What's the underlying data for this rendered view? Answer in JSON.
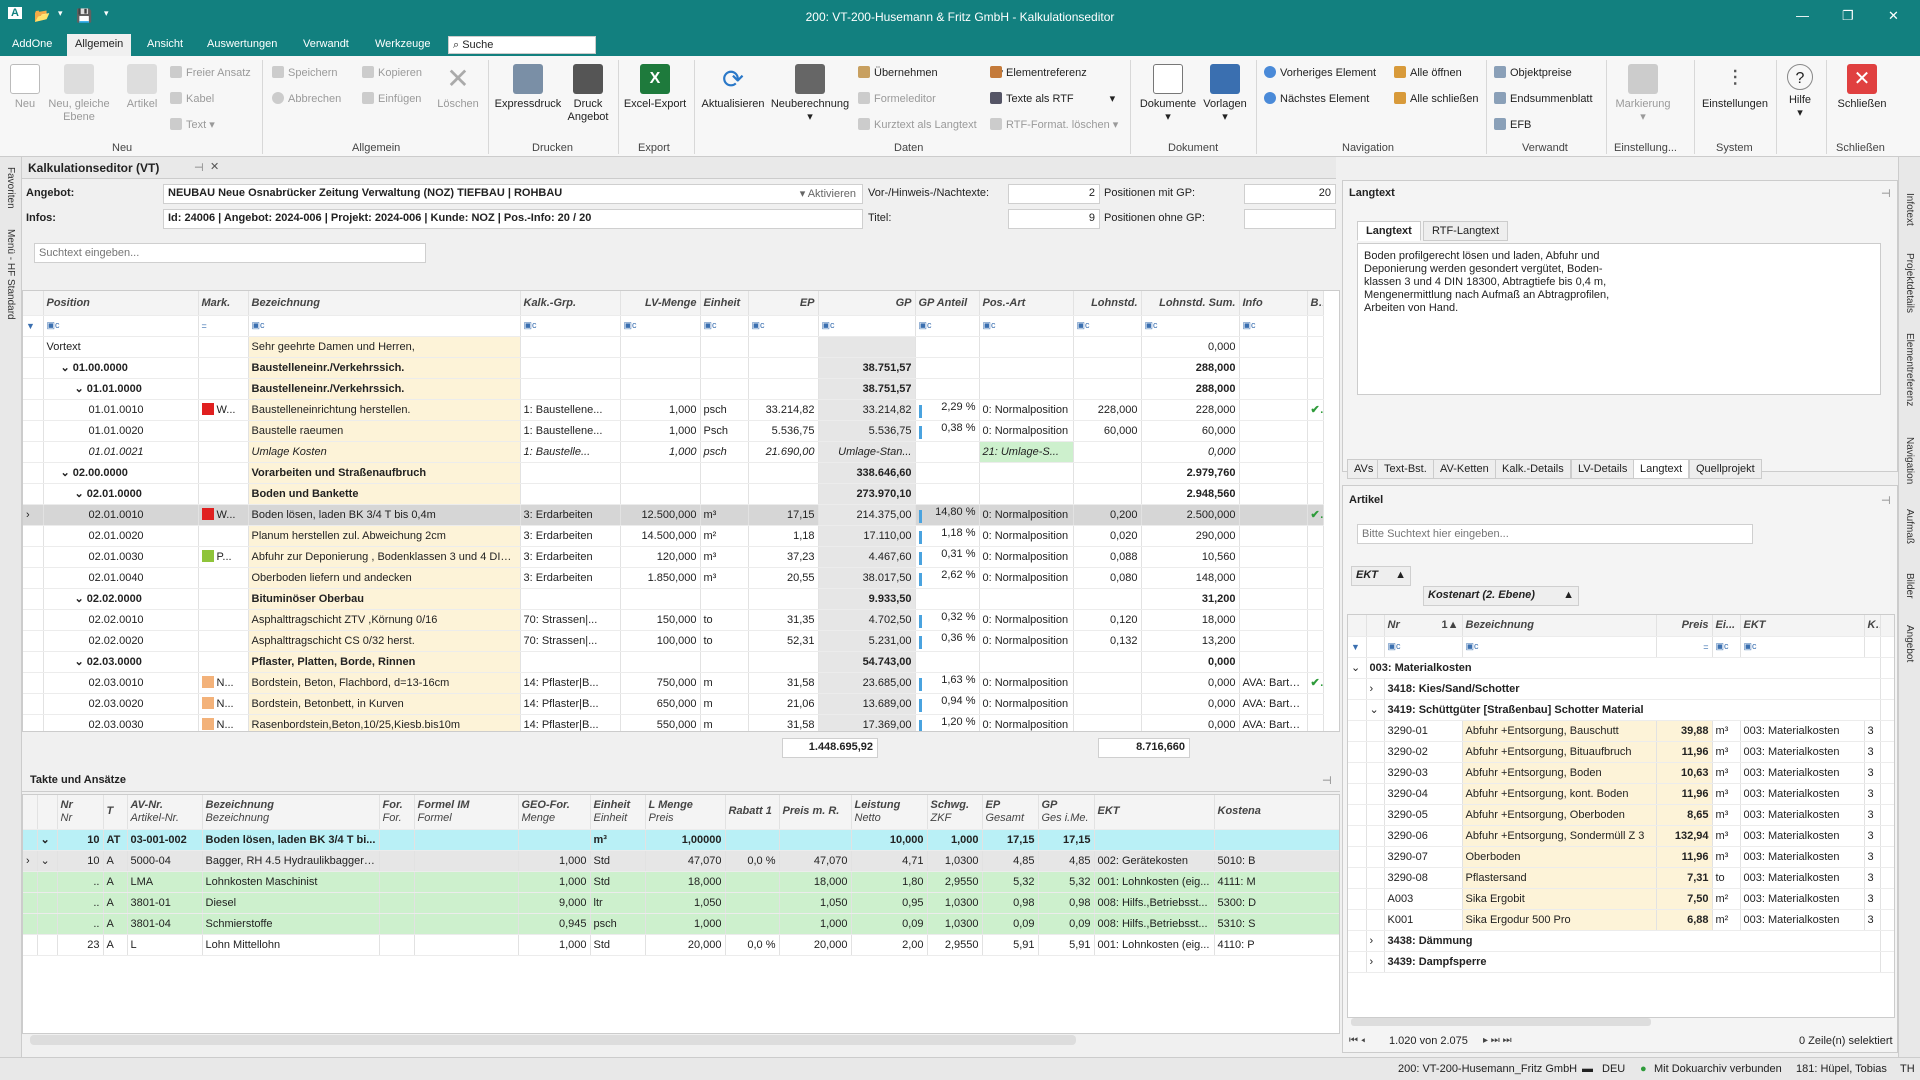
{
  "window": {
    "title": "200: VT-200-Husemann & Fritz GmbH - Kalkulationseditor",
    "app_letter": "A"
  },
  "menu": {
    "items": [
      "AddOne",
      "Allgemein",
      "Ansicht",
      "Auswertungen",
      "Verwandt",
      "Werkzeuge"
    ],
    "search_value": "Suche"
  },
  "ribbon": {
    "neu": "Neu",
    "neu_gleiche": "Neu, gleiche",
    "ebene": "Ebene",
    "artikel": "Artikel",
    "freier_ansatz": "Freier Ansatz",
    "kabel": "Kabel",
    "text": "Text",
    "speichern": "Speichern",
    "abbrechen": "Abbrechen",
    "kopieren": "Kopieren",
    "einfuegen": "Einfügen",
    "loeschen": "Löschen",
    "expressdruck": "Expressdruck",
    "druck": "Druck",
    "angebot": "Angebot",
    "excel_export": "Excel-Export",
    "aktualisieren": "Aktualisieren",
    "neuberechnung": "Neuberechnung",
    "uebernehmen": "Übernehmen",
    "formeleditor": "Formeleditor",
    "kurztext": "Kurztext als Langtext",
    "elementreferenz": "Elementreferenz",
    "texte_rtf": "Texte als RTF",
    "rtf_loeschen": "RTF-Format. löschen",
    "dokumente": "Dokumente",
    "vorlagen": "Vorlagen",
    "vorheriges": "Vorheriges Element",
    "naechstes": "Nächstes Element",
    "alle_oeffnen": "Alle öffnen",
    "alle_schliessen": "Alle schließen",
    "objektpreise": "Objektpreise",
    "endsummenblatt": "Endsummenblatt",
    "efb": "EFB",
    "markierung": "Markierung",
    "einstellungen": "Einstellungen",
    "hilfe": "Hilfe",
    "schliessen": "Schließen",
    "groups": [
      "Neu",
      "Allgemein",
      "Drucken",
      "Export",
      "Daten",
      "Dokument",
      "Navigation",
      "Verwandt",
      "Einstellung...",
      "System",
      "Schließen"
    ]
  },
  "left_strip": [
    "Favoriten",
    "Menü - HF Standard"
  ],
  "right_strip": [
    "Infotext",
    "Projektdetails",
    "Elementreferenz",
    "Navigation",
    "Aufmaß",
    "Bilder",
    "Angebot"
  ],
  "editor": {
    "tab_title": "Kalkulationseditor (VT)",
    "angebot_label": "Angebot:",
    "angebot_value": "NEUBAU Neue Osnabrücker Zeitung Verwaltung (NOZ) TIEFBAU | ROHBAU",
    "aktivieren": "Aktivieren",
    "infos_label": "Infos:",
    "infos_value": "Id: 24006 | Angebot: 2024-006 | Projekt: 2024-006 | Kunde: NOZ | Pos.-Info: 20 / 20",
    "vor_label": "Vor-/Hinweis-/Nachtexte:",
    "vor_value": "2",
    "titel_label": "Titel:",
    "titel_value": "9",
    "pos_gp_label": "Positionen mit GP:",
    "pos_gp_value": "20",
    "pos_ohne_label": "Positionen ohne GP:",
    "pos_ohne_value": "",
    "search_placeholder": "Suchtext eingeben...",
    "columns": [
      "Position",
      "Mark.",
      "Bezeichnung",
      "Kalk.-Grp.",
      "LV-Menge",
      "Einheit",
      "EP",
      "GP",
      "GP Anteil",
      "Pos.-Art",
      "Lohnstd.",
      "Lohnstd. Sum.",
      "Info",
      "Bilder"
    ],
    "rows": [
      {
        "pos": "Vortext",
        "bez": "Sehr geehrte Damen und Herren,",
        "ls": "0,000",
        "lvl": 0,
        "type": "text"
      },
      {
        "pos": "01.00.0000",
        "bez": "Baustelleneinr./Verkehrssich.",
        "gp": "38.751,57",
        "ls": "288,000",
        "lvl": 1,
        "type": "bold"
      },
      {
        "pos": "01.01.0000",
        "bez": "Baustelleneinr./Verkehrssich.",
        "gp": "38.751,57",
        "ls": "288,000",
        "lvl": 2,
        "type": "bold"
      },
      {
        "pos": "01.01.0010",
        "mark": "W...",
        "mc": "#e02020",
        "bez": "Baustelleneinrichtung herstellen.",
        "kg": "1: Baustellene...",
        "menge": "1,000",
        "eh": "psch",
        "ep": "33.214,82",
        "gp": "33.214,82",
        "ant": "2,29 %",
        "art": "0: Normalposition",
        "lh": "228,000",
        "ls": "228,000",
        "chk": "✔",
        "lvl": 3
      },
      {
        "pos": "01.01.0020",
        "bez": "Baustelle raeumen",
        "kg": "1: Baustellene...",
        "menge": "1,000",
        "eh": "Psch",
        "ep": "5.536,75",
        "gp": "5.536,75",
        "ant": "0,38 %",
        "art": "0: Normalposition",
        "lh": "60,000",
        "ls": "60,000",
        "lvl": 3
      },
      {
        "pos": "01.01.0021",
        "bez": "Umlage Kosten",
        "kg": "1: Baustelle...",
        "menge": "1,000",
        "eh": "psch",
        "ep": "21.690,00",
        "gp": "Umlage-Stan...",
        "art": "21: Umlage-S...",
        "ls": "0,000",
        "lvl": 3,
        "type": "italic"
      },
      {
        "pos": "02.00.0000",
        "bez": "Vorarbeiten und Straßenaufbruch",
        "gp": "338.646,60",
        "ls": "2.979,760",
        "lvl": 1,
        "type": "bold"
      },
      {
        "pos": "02.01.0000",
        "bez": "Boden und Bankette",
        "gp": "273.970,10",
        "ls": "2.948,560",
        "lvl": 2,
        "type": "bold"
      },
      {
        "pos": "02.01.0010",
        "mark": "W...",
        "mc": "#e02020",
        "bez": "Boden lösen, laden BK 3/4 T bis 0,4m",
        "kg": "3: Erdarbeiten",
        "menge": "12.500,000",
        "eh": "m³",
        "ep": "17,15",
        "gp": "214.375,00",
        "ant": "14,80 %",
        "art": "0: Normalposition",
        "lh": "0,200",
        "ls": "2.500,000",
        "chk": "✔",
        "lvl": 3,
        "type": "sel"
      },
      {
        "pos": "02.01.0020",
        "bez": "Planum herstellen zul. Abweichung 2cm",
        "kg": "3: Erdarbeiten",
        "menge": "14.500,000",
        "eh": "m²",
        "ep": "1,18",
        "gp": "17.110,00",
        "ant": "1,18 %",
        "art": "0: Normalposition",
        "lh": "0,020",
        "ls": "290,000",
        "lvl": 3
      },
      {
        "pos": "02.01.0030",
        "mark": "P...",
        "mc": "#8fc43a",
        "bez": "Abfuhr zur Deponierung , Bodenklassen 3 und 4 DIN ...",
        "kg": "3: Erdarbeiten",
        "menge": "120,000",
        "eh": "m³",
        "ep": "37,23",
        "gp": "4.467,60",
        "ant": "0,31 %",
        "art": "0: Normalposition",
        "lh": "0,088",
        "ls": "10,560",
        "lvl": 3
      },
      {
        "pos": "02.01.0040",
        "bez": "Oberboden liefern und andecken",
        "kg": "3: Erdarbeiten",
        "menge": "1.850,000",
        "eh": "m³",
        "ep": "20,55",
        "gp": "38.017,50",
        "ant": "2,62 %",
        "art": "0: Normalposition",
        "lh": "0,080",
        "ls": "148,000",
        "lvl": 3
      },
      {
        "pos": "02.02.0000",
        "bez": "Bituminöser Oberbau",
        "gp": "9.933,50",
        "ls": "31,200",
        "lvl": 2,
        "type": "bold"
      },
      {
        "pos": "02.02.0010",
        "bez": "Asphalttragschicht ZTV ,Körnung 0/16",
        "kg": "70: Strassen|...",
        "menge": "150,000",
        "eh": "to",
        "ep": "31,35",
        "gp": "4.702,50",
        "ant": "0,32 %",
        "art": "0: Normalposition",
        "lh": "0,120",
        "ls": "18,000",
        "lvl": 3
      },
      {
        "pos": "02.02.0020",
        "bez": "Asphalttragschicht CS 0/32 herst.",
        "kg": "70: Strassen|...",
        "menge": "100,000",
        "eh": "to",
        "ep": "52,31",
        "gp": "5.231,00",
        "ant": "0,36 %",
        "art": "0: Normalposition",
        "lh": "0,132",
        "ls": "13,200",
        "lvl": 3
      },
      {
        "pos": "02.03.0000",
        "bez": "Pflaster, Platten, Borde, Rinnen",
        "gp": "54.743,00",
        "ls": "0,000",
        "lvl": 2,
        "type": "bold"
      },
      {
        "pos": "02.03.0010",
        "mark": "N...",
        "mc": "#f3b27a",
        "bez": "Bordstein, Beton, Flachbord, d=13-16cm",
        "kg": "14: Pflaster|B...",
        "menge": "750,000",
        "eh": "m",
        "ep": "31,58",
        "gp": "23.685,00",
        "ant": "1,63 %",
        "art": "0: Normalposition",
        "lh": "",
        "ls": "0,000",
        "info": "AVA: Bartz-Ba...",
        "chk": "✔",
        "lvl": 3
      },
      {
        "pos": "02.03.0020",
        "mark": "N...",
        "mc": "#f3b27a",
        "bez": "Bordstein, Betonbett, in Kurven",
        "kg": "14: Pflaster|B...",
        "menge": "650,000",
        "eh": "m",
        "ep": "21,06",
        "gp": "13.689,00",
        "ant": "0,94 %",
        "art": "0: Normalposition",
        "lh": "",
        "ls": "0,000",
        "info": "AVA: Bartz-Ba...",
        "lvl": 3
      },
      {
        "pos": "02.03.0030",
        "mark": "N...",
        "mc": "#f3b27a",
        "bez": "Rasenbordstein,Beton,10/25,Kiesb.bis10m",
        "kg": "14: Pflaster|B...",
        "menge": "550,000",
        "eh": "m",
        "ep": "31,58",
        "gp": "17.369,00",
        "ant": "1,20 %",
        "art": "0: Normalposition",
        "lh": "",
        "ls": "0,000",
        "info": "AVA: Bartz-Ba...",
        "lvl": 3
      }
    ],
    "total_gp": "1.448.695,92",
    "total_ls": "8.716,660"
  },
  "takte": {
    "title": "Takte und Ansätze",
    "columns": [
      [
        "Nr",
        "Nr"
      ],
      [
        "T",
        ""
      ],
      [
        "AV-Nr.",
        "Artikel-Nr."
      ],
      [
        "Bezeichnung",
        "Bezeichnung"
      ],
      [
        "For.",
        "For."
      ],
      [
        "Formel IM",
        "Formel"
      ],
      [
        "GEO-For.",
        "Menge"
      ],
      [
        "Einheit",
        "Einheit"
      ],
      [
        "L Menge",
        "Preis"
      ],
      [
        "Rabatt 1",
        ""
      ],
      [
        "Preis m. R.",
        ""
      ],
      [
        "Leistung",
        "Netto"
      ],
      [
        "Schwg.",
        "ZKF"
      ],
      [
        "EP",
        "Gesamt"
      ],
      [
        "GP",
        "Ges i.Me."
      ],
      [
        "EKT",
        ""
      ],
      [
        "Kostena",
        ""
      ]
    ],
    "rows": [
      {
        "nr": "10",
        "t": "AT",
        "av": "03-001-002",
        "bez": "Boden lösen, laden BK 3/4 T bi...",
        "eh": "m³",
        "lm": "1,00000",
        "lei": "10,000",
        "sch": "1,000",
        "ep": "17,15",
        "gp": "17,15",
        "cls": "cyan"
      },
      {
        "nr": "10",
        "t": "A",
        "av": "5000-04",
        "bez": "Bagger, RH 4.5 Hydraulikbagger mi...",
        "geo": "1,000",
        "eh": "Std",
        "lm": "47,070",
        "rab": "0,0 %",
        "pmr": "47,070",
        "lei": "4,71",
        "sch": "1,0300",
        "ep": "4,85",
        "gp": "4,85",
        "ekt": "002: Gerätekosten",
        "ko": "5010: B",
        "cls": "grey"
      },
      {
        "nr": "..",
        "t": "A",
        "av": "LMA",
        "bez": "Lohnkosten Maschinist",
        "geo": "1,000",
        "eh": "Std",
        "lm": "18,000",
        "pmr": "18,000",
        "lei": "1,80",
        "sch": "2,9550",
        "ep": "5,32",
        "gp": "5,32",
        "ekt": "001: Lohnkosten (eig...",
        "ko": "4111: M",
        "cls": "grn"
      },
      {
        "nr": "..",
        "t": "A",
        "av": "3801-01",
        "bez": "Diesel",
        "geo": "9,000",
        "eh": "ltr",
        "lm": "1,050",
        "pmr": "1,050",
        "lei": "0,95",
        "sch": "1,0300",
        "ep": "0,98",
        "gp": "0,98",
        "ekt": "008: Hilfs.,Betriebsst...",
        "ko": "5300: D",
        "cls": "grn"
      },
      {
        "nr": "..",
        "t": "A",
        "av": "3801-04",
        "bez": "Schmierstoffe",
        "geo": "0,945",
        "eh": "psch",
        "lm": "1,000",
        "pmr": "1,000",
        "lei": "0,09",
        "sch": "1,0300",
        "ep": "0,09",
        "gp": "0,09",
        "ekt": "008: Hilfs.,Betriebsst...",
        "ko": "5310: S",
        "cls": "grn"
      },
      {
        "nr": "23",
        "t": "A",
        "av": "L",
        "bez": "Lohn Mittellohn",
        "geo": "1,000",
        "eh": "Std",
        "lm": "20,000",
        "rab": "0,0 %",
        "pmr": "20,000",
        "lei": "2,00",
        "sch": "2,9550",
        "ep": "5,91",
        "gp": "5,91",
        "ekt": "001: Lohnkosten (eig...",
        "ko": "4110: P",
        "cls": ""
      }
    ]
  },
  "langtext": {
    "title": "Langtext",
    "tab1": "Langtext",
    "tab2": "RTF-Langtext",
    "lines": [
      "Boden profilgerecht lösen und laden, Abfuhr und",
      "Deponierung werden gesondert vergütet, Boden-",
      "klassen 3 und 4 DIN 18300, Abtragtiefe bis 0,4 m,",
      "Mengenermittlung nach Aufmaß an Abtragprofilen,",
      "Arbeiten von Hand."
    ],
    "bottom_tabs": [
      "AVs",
      "Text-Bst.",
      "AV-Ketten",
      "Kalk.-Details",
      "LV-Details",
      "Langtext",
      "Quellprojekt"
    ]
  },
  "artikel": {
    "title": "Artikel",
    "search_placeholder": "Bitte Suchtext hier eingeben...",
    "ekt": "EKT",
    "kostenart": "Kostenart (2. Ebene)",
    "columns": [
      "Nr",
      "Bezeichnung",
      "Preis",
      "Ei...",
      "EKT",
      "Kos"
    ],
    "groups": {
      "g003": "003: Materialkosten",
      "g3418": "3418: Kies/Sand/Schotter",
      "g3419": "3419: Schüttgüter [Straßenbau] Schotter Material",
      "g3438": "3438: Dämmung",
      "g3439": "3439: Dampfsperre"
    },
    "items": [
      {
        "nr": "3290-01",
        "bez": "Abfuhr +Entsorgung, Bauschutt",
        "preis": "39,88",
        "eh": "m³",
        "ekt": "003: Materialkosten",
        "k": "3"
      },
      {
        "nr": "3290-02",
        "bez": "Abfuhr +Entsorgung, Bituaufbruch",
        "preis": "11,96",
        "eh": "m³",
        "ekt": "003: Materialkosten",
        "k": "3"
      },
      {
        "nr": "3290-03",
        "bez": "Abfuhr +Entsorgung, Boden",
        "preis": "10,63",
        "eh": "m³",
        "ekt": "003: Materialkosten",
        "k": "3"
      },
      {
        "nr": "3290-04",
        "bez": "Abfuhr +Entsorgung, kont. Boden",
        "preis": "11,96",
        "eh": "m³",
        "ekt": "003: Materialkosten",
        "k": "3"
      },
      {
        "nr": "3290-05",
        "bez": "Abfuhr +Entsorgung, Oberboden",
        "preis": "8,65",
        "eh": "m³",
        "ekt": "003: Materialkosten",
        "k": "3"
      },
      {
        "nr": "3290-06",
        "bez": "Abfuhr +Entsorgung, Sondermüll   Z 3",
        "preis": "132,94",
        "eh": "m³",
        "ekt": "003: Materialkosten",
        "k": "3"
      },
      {
        "nr": "3290-07",
        "bez": "Oberboden",
        "preis": "11,96",
        "eh": "m³",
        "ekt": "003: Materialkosten",
        "k": "3"
      },
      {
        "nr": "3290-08",
        "bez": "Pflastersand",
        "preis": "7,31",
        "eh": "to",
        "ekt": "003: Materialkosten",
        "k": "3"
      },
      {
        "nr": "A003",
        "bez": "Sika Ergobit",
        "preis": "7,50",
        "eh": "m²",
        "ekt": "003: Materialkosten",
        "k": "3"
      },
      {
        "nr": "K001",
        "bez": "Sika Ergodur 500 Pro",
        "preis": "6,88",
        "eh": "m²",
        "ekt": "003: Materialkosten",
        "k": "3"
      }
    ],
    "pager": "1.020 von 2.075",
    "selected": "0 Zeile(n) selektiert"
  },
  "status": {
    "company": "200: VT-200-Husemann_Fritz GmbH",
    "lang": "DEU",
    "dokuarchiv": "Mit Dokuarchiv verbunden",
    "user": "181: Hüpel, Tobias",
    "th": "TH"
  }
}
